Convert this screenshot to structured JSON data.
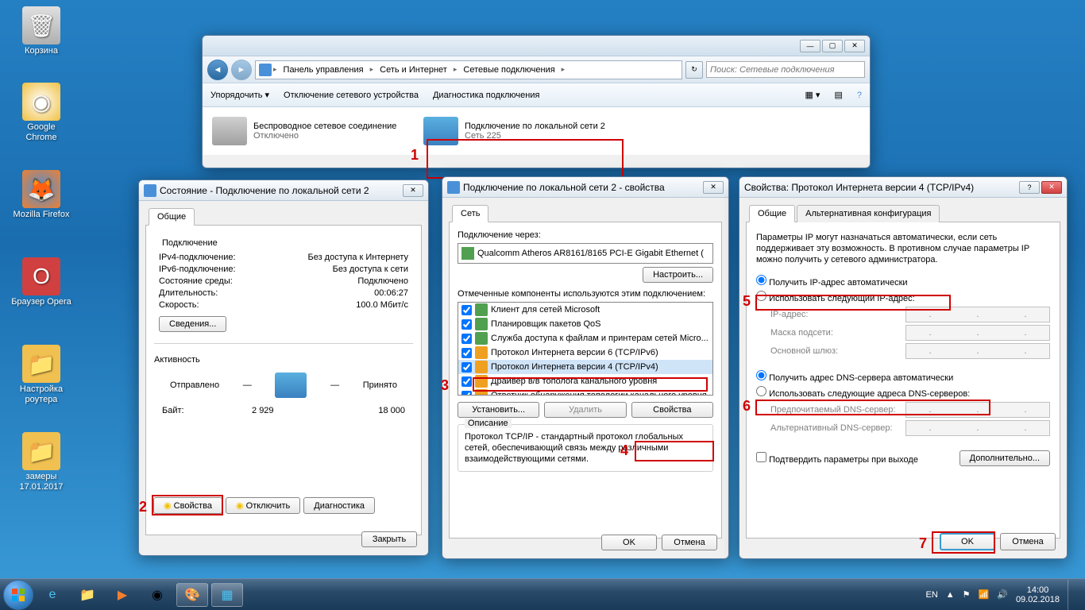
{
  "desktop": {
    "recycle": "Корзина",
    "chrome": "Google Chrome",
    "firefox": "Mozilla Firefox",
    "opera": "Браузер Opera",
    "router": "Настройка роутера",
    "folder": "замеры 17.01.2017"
  },
  "explorer": {
    "bc1": "Панель управления",
    "bc2": "Сеть и Интернет",
    "bc3": "Сетевые подключения",
    "search_ph": "Поиск: Сетевые подключения",
    "cmd1": "Упорядочить",
    "cmd2": "Отключение сетевого устройства",
    "cmd3": "Диагностика подключения",
    "conn1_name": "Беспроводное сетевое соединение",
    "conn1_status": "Отключено",
    "conn2_name": "Подключение по локальной сети 2",
    "conn2_status": "Сеть 225"
  },
  "status": {
    "title": "Состояние - Подключение по локальной сети 2",
    "tab": "Общие",
    "grp_conn": "Подключение",
    "ipv4_l": "IPv4-подключение:",
    "ipv4_v": "Без доступа к Интернету",
    "ipv6_l": "IPv6-подключение:",
    "ipv6_v": "Без доступа к сети",
    "media_l": "Состояние среды:",
    "media_v": "Подключено",
    "dur_l": "Длительность:",
    "dur_v": "00:06:27",
    "speed_l": "Скорость:",
    "speed_v": "100.0 Мбит/с",
    "details": "Сведения...",
    "grp_act": "Активность",
    "sent": "Отправлено",
    "recv": "Принято",
    "bytes_l": "Байт:",
    "bytes_s": "2 929",
    "bytes_r": "18 000",
    "btn_prop": "Свойства",
    "btn_disable": "Отключить",
    "btn_diag": "Диагностика",
    "btn_close": "Закрыть"
  },
  "props": {
    "title": "Подключение по локальной сети 2 - свойства",
    "tab": "Сеть",
    "conn_via": "Подключение через:",
    "adapter": "Qualcomm Atheros AR8161/8165 PCI-E Gigabit Ethernet (",
    "btn_conf": "Настроить...",
    "components_lbl": "Отмеченные компоненты используются этим подключением:",
    "items": [
      "Клиент для сетей Microsoft",
      "Планировщик пакетов QoS",
      "Служба доступа к файлам и принтерам сетей Micro...",
      "Протокол Интернета версии 6 (TCP/IPv6)",
      "Протокол Интернета версии 4 (TCP/IPv4)",
      "Драйвер в/в тополога канального уровня",
      "Ответчик обнаружения топологии канального уровня"
    ],
    "btn_install": "Установить...",
    "btn_remove": "Удалить",
    "btn_props": "Свойства",
    "desc_lbl": "Описание",
    "desc_txt": "Протокол TCP/IP - стандартный протокол глобальных сетей, обеспечивающий связь между различными взаимодействующими сетями.",
    "ok": "OK",
    "cancel": "Отмена"
  },
  "ipv4": {
    "title": "Свойства: Протокол Интернета версии 4 (TCP/IPv4)",
    "tab1": "Общие",
    "tab2": "Альтернативная конфигурация",
    "intro": "Параметры IP могут назначаться автоматически, если сеть поддерживает эту возможность. В противном случае параметры IP можно получить у сетевого администратора.",
    "r_auto_ip": "Получить IP-адрес автоматически",
    "r_man_ip": "Использовать следующий IP-адрес:",
    "ip_l": "IP-адрес:",
    "mask_l": "Маска подсети:",
    "gw_l": "Основной шлюз:",
    "r_auto_dns": "Получить адрес DNS-сервера автоматически",
    "r_man_dns": "Использовать следующие адреса DNS-серверов:",
    "dns1_l": "Предпочитаемый DNS-сервер:",
    "dns2_l": "Альтернативный DNS-сервер:",
    "chk_validate": "Подтвердить параметры при выходе",
    "btn_adv": "Дополнительно...",
    "ok": "OK",
    "cancel": "Отмена"
  },
  "annotations": {
    "n1": "1",
    "n2": "2",
    "n3": "3",
    "n4": "4",
    "n5": "5",
    "n6": "6",
    "n7": "7"
  },
  "tray": {
    "lang": "EN",
    "time": "14:00",
    "date": "09.02.2018"
  }
}
